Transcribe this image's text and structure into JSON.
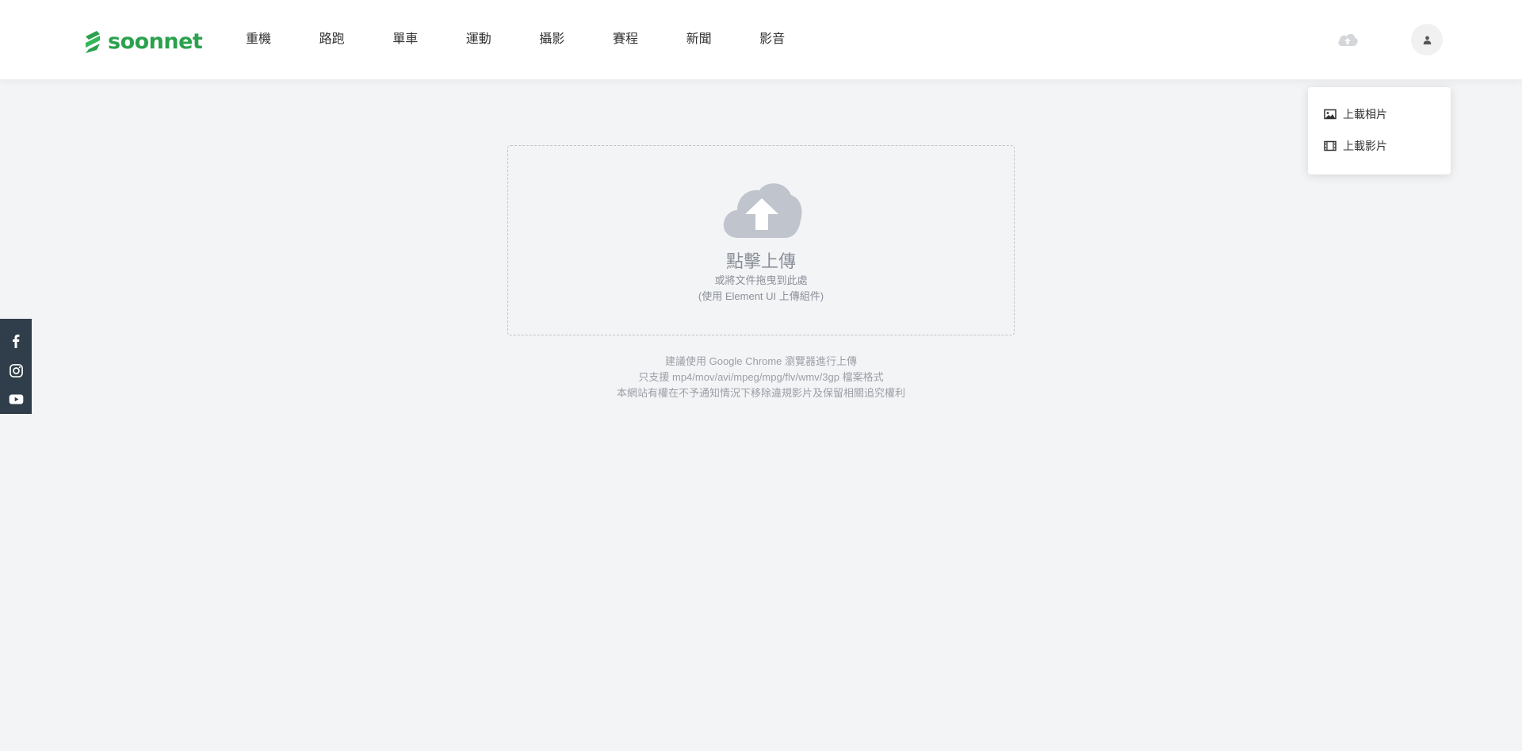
{
  "header": {
    "logo_text": "soonnet",
    "nav": [
      "重機",
      "路跑",
      "單車",
      "運動",
      "攝影",
      "賽程",
      "新聞",
      "影音"
    ]
  },
  "dropdown": {
    "items": [
      {
        "label": "上載相片",
        "icon": "image-icon"
      },
      {
        "label": "上載影片",
        "icon": "film-icon"
      }
    ]
  },
  "social": [
    "facebook-icon",
    "instagram-icon",
    "youtube-icon"
  ],
  "upload": {
    "title": "點擊上傳",
    "subtitle": "或將文件拖曳到此處",
    "subtitle2": "(使用 Element UI 上傳組件)"
  },
  "notes": [
    "建議使用 Google Chrome 瀏覽器進行上傳",
    "只支援 mp4/mov/avi/mpeg/mpg/flv/wmv/3gp 檔案格式",
    "本網站有權在不予通知情況下移除違規影片及保留相關追究權利"
  ],
  "colors": {
    "brand": "#2aa14d",
    "background": "#f3f4f6",
    "sidebar": "#2f3e4a",
    "upload_icon": "#c0c4cc"
  }
}
